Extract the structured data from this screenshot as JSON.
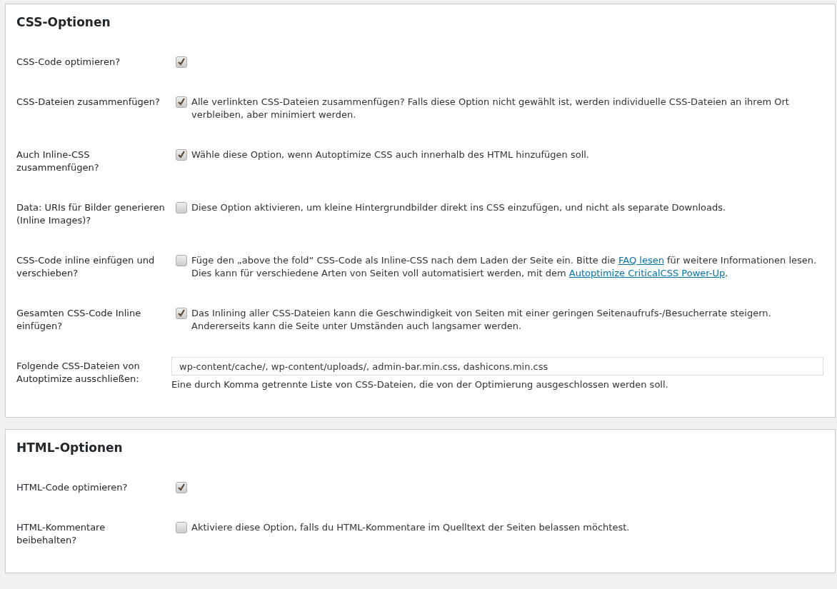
{
  "panels": [
    {
      "title": "CSS-Optionen",
      "rows": [
        {
          "kind": "checkbox",
          "label": "CSS-Code optimieren?",
          "checked": true
        },
        {
          "kind": "checkbox",
          "label": "CSS-Dateien zusammenfügen?",
          "checked": true,
          "description": [
            {
              "kind": "text",
              "text": "Alle verlinkten CSS-Dateien zusammenfügen? Falls diese Option nicht gewählt ist, werden individuelle CSS-Dateien an ihrem Ort verbleiben, aber minimiert werden."
            }
          ]
        },
        {
          "kind": "checkbox",
          "label": "Auch Inline-CSS zusammenfügen?",
          "checked": true,
          "description": [
            {
              "kind": "text",
              "text": "Wähle diese Option, wenn Autoptimize CSS auch innerhalb des HTML hinzufügen soll."
            }
          ]
        },
        {
          "kind": "checkbox",
          "label": "Data: URIs für Bilder generieren (Inline Images)?",
          "checked": false,
          "description": [
            {
              "kind": "text",
              "text": "Diese Option aktivieren, um kleine Hintergrundbilder direkt ins CSS einzufügen, und nicht als separate Downloads."
            }
          ]
        },
        {
          "kind": "checkbox",
          "label": "CSS-Code inline einfügen und verschieben?",
          "checked": false,
          "description": [
            {
              "kind": "text",
              "text": "Füge den „above the fold“ CSS-Code als Inline-CSS nach dem Laden der Seite ein. Bitte die "
            },
            {
              "kind": "link",
              "text": "FAQ lesen"
            },
            {
              "kind": "text",
              "text": " für weitere Informationen lesen. Dies kann für verschiedene Arten von Seiten voll automatisiert werden, mit dem "
            },
            {
              "kind": "link",
              "text": "Autoptimize CriticalCSS Power-Up"
            },
            {
              "kind": "text",
              "text": "."
            }
          ]
        },
        {
          "kind": "checkbox",
          "label": "Gesamten CSS-Code Inline einfügen?",
          "checked": true,
          "description": [
            {
              "kind": "text",
              "text": "Das Inlining aller CSS-Dateien kann die Geschwindigkeit von Seiten mit einer geringen Seitenaufrufs-/Besucherrate steigern. Andererseits kann die Seite unter Umständen auch langsamer werden."
            }
          ]
        },
        {
          "kind": "text-input",
          "label": "Folgende CSS-Dateien von Autoptimize ausschließen:",
          "value": "wp-content/cache/, wp-content/uploads/, admin-bar.min.css, dashicons.min.css",
          "hint": "Eine durch Komma getrennte Liste von CSS-Dateien, die von der Optimierung ausgeschlossen werden soll."
        }
      ]
    },
    {
      "title": "HTML-Optionen",
      "rows": [
        {
          "kind": "checkbox",
          "label": "HTML-Code optimieren?",
          "checked": true
        },
        {
          "kind": "checkbox",
          "label": "HTML-Kommentare beibehalten?",
          "checked": false,
          "description": [
            {
              "kind": "text",
              "text": "Aktiviere diese Option, falls du HTML-Kommentare im Quelltext der Seiten belassen möchtest."
            }
          ]
        }
      ]
    }
  ]
}
